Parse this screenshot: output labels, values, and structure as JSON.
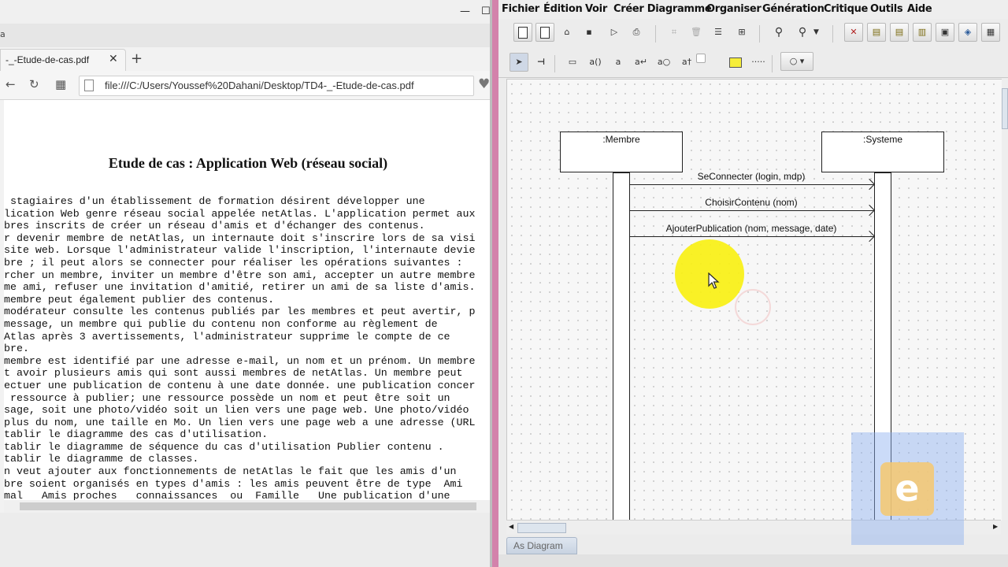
{
  "browser": {
    "window_controls": {
      "minimize": "—",
      "maximize": "☐"
    },
    "mini_tab_text": "a",
    "tab": {
      "title": "-_-Etude-de-cas.pdf",
      "close": "✕"
    },
    "new_tab": "+",
    "nav": {
      "back": "←",
      "reload": "↻",
      "apps": "▦"
    },
    "url": "file:///C:/Users/Youssef%20Dahani/Desktop/TD4-_-Etude-de-cas.pdf",
    "heart": "♥",
    "pdf": {
      "title": "Etude de cas : Application Web (réseau social)",
      "lines": [
        " stagiaires d'un établissement de formation désirent développer une",
        "lication Web genre réseau social appelée netAtlas. L'application permet aux",
        "bres inscrits de créer un réseau d'amis et d'échanger des contenus.",
        "r devenir membre de netAtlas, un internaute doit s'inscrire lors de sa visi",
        "site web. Lorsque l'administrateur valide l'inscription, l'internaute devie",
        "bre ; il peut alors se connecter pour réaliser les opérations suivantes :",
        "rcher un membre, inviter un membre d'être son ami, accepter un autre membre",
        "me ami, refuser une invitation d'amitié, retirer un ami de sa liste d'amis.",
        "membre peut également publier des contenus.",
        "modérateur consulte les contenus publiés par les membres et peut avertir, p",
        "message, un membre qui publie du contenu non conforme au règlement de",
        "Atlas après 3 avertissements, l'administrateur supprime le compte de ce",
        "bre.",
        "membre est identifié par une adresse e-mail, un nom et un prénom. Un membre",
        "t avoir plusieurs amis qui sont aussi membres de netAtlas. Un membre peut",
        "ectuer une publication de contenu à une date donnée. une publication concer",
        " ressource à publier; une ressource possède un nom et peut être soit un",
        "sage, soit une photo/vidéo soit un lien vers une page web. Une photo/vidéo",
        "plus du nom, une taille en Mo. Un lien vers une page web a une adresse (URL",
        "tablir le diagramme des cas d'utilisation.",
        "tablir le diagramme de séquence du cas d'utilisation Publier contenu .",
        "tablir le diagramme de classes.",
        "n veut ajouter aux fonctionnements de netAtlas le fait que les amis d'un",
        "bre soient organisés en types d'amis : les amis peuvent être de type  Ami",
        "mal   Amis proches   connaissances  ou  Famille   Une publication d'une"
      ]
    }
  },
  "uml": {
    "menu": [
      "Fichier",
      "Édition",
      "Voir",
      "Créer Diagramme",
      "Organiser",
      "Génération",
      "Critique",
      "Outils",
      "Aide"
    ],
    "toolbar2_labels": {
      "rect": "▭",
      "text_a_paren": "a()",
      "text_a_hook": "a",
      "text_a_ret": "a↵",
      "text_a_o": "a○",
      "text_a_t": "a†",
      "dots": "·····"
    },
    "diagram": {
      "lifelines": [
        ":Membre",
        ":Systeme"
      ],
      "messages": [
        "SeConnecter (login, mdp)",
        "ChoisirContenu (nom)",
        "AjouterPublication (nom, message, date)"
      ]
    },
    "diagram_tab": "As Diagram"
  },
  "watermark": {
    "letter": "e"
  },
  "colors": {
    "pink_border": "#d382ab",
    "cursor_highlight": "#f8f014",
    "watermark": "#8cafef"
  }
}
